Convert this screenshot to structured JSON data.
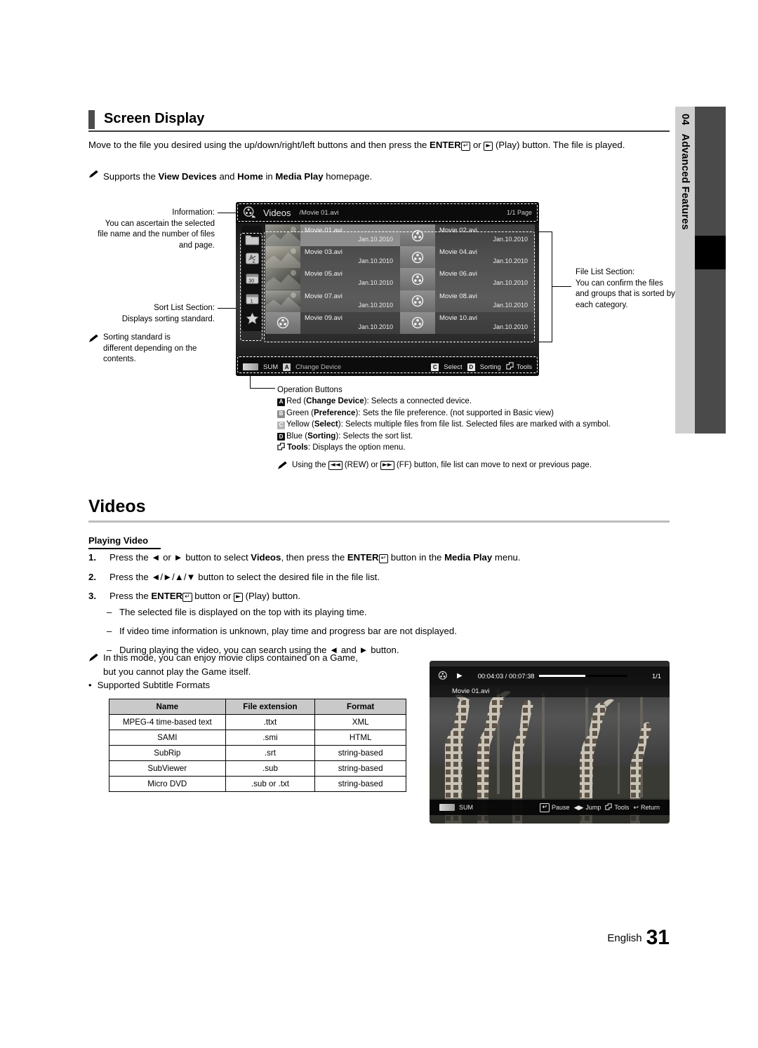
{
  "chapter_tab": {
    "number": "04",
    "label": "Advanced Features"
  },
  "section": {
    "title": "Screen Display",
    "intro_p1_a": "Move to the file you desired using the up/down/right/left buttons and then press the ",
    "intro_enter": "ENTER",
    "intro_enter_key": "↵",
    "intro_p1_b": " or ",
    "intro_play_key": "►",
    "intro_p1_c": " (Play) button. The file is played.",
    "note_a": "Supports the ",
    "note_b": "View Devices",
    "note_c": " and ",
    "note_d": "Home",
    "note_e": " in ",
    "note_f": "Media Play",
    "note_g": " homepage."
  },
  "callouts": {
    "information": "Information:\nYou can ascertain the selected file name and the number of files and page.",
    "information_l1": "Information:",
    "information_l2": "You can ascertain the selected",
    "information_l3": "file name and the number of files",
    "information_l4": "and page.",
    "sort_l1": "Sort List Section:",
    "sort_l2": "Displays sorting standard.",
    "sort_note_l1": "Sorting standard is",
    "sort_note_l2": "different depending on the",
    "sort_note_l3": "contents.",
    "filelist_l1": "File List Section:",
    "filelist_l2": "You can confirm the files",
    "filelist_l3": "and groups that is sorted by",
    "filelist_l4": "each category."
  },
  "tv_screen": {
    "header": {
      "title": "Videos",
      "path": "/Movie 01.avi",
      "page": "1/1 Page"
    },
    "sort_icons": [
      "folder-icon",
      "alphabet-sort-icon",
      "calendar-month-icon",
      "calendar-day-icon",
      "star-icon"
    ],
    "files": [
      {
        "name": "Movie 01.avi",
        "date": "Jan.10.2010",
        "thumb": "photo",
        "selected": true
      },
      {
        "name": "Movie 02.avi",
        "date": "Jan.10.2010",
        "thumb": "reel",
        "selected": false
      },
      {
        "name": "Movie 03.avi",
        "date": "Jan.10.2010",
        "thumb": "photo",
        "selected": false
      },
      {
        "name": "Movie 04.avi",
        "date": "Jan.10.2010",
        "thumb": "reel",
        "selected": false
      },
      {
        "name": "Movie 05.avi",
        "date": "Jan.10.2010",
        "thumb": "photo",
        "selected": false
      },
      {
        "name": "Movie 06.avi",
        "date": "Jan.10.2010",
        "thumb": "reel",
        "selected": false
      },
      {
        "name": "Movie 07.avi",
        "date": "Jan.10.2010",
        "thumb": "photo",
        "selected": false
      },
      {
        "name": "Movie 08.avi",
        "date": "Jan.10.2010",
        "thumb": "reel",
        "selected": false
      },
      {
        "name": "Movie 09.avi",
        "date": "Jan.10.2010",
        "thumb": "reel",
        "selected": false
      },
      {
        "name": "Movie 10.avi",
        "date": "Jan.10.2010",
        "thumb": "reel",
        "selected": false
      }
    ],
    "footer": {
      "sum": "SUM",
      "a_badge": "A",
      "change_device": "Change Device",
      "c_badge": "C",
      "select": "Select",
      "d_badge": "D",
      "sorting": "Sorting",
      "tools": "Tools"
    }
  },
  "operation_buttons": {
    "heading": "Operation Buttons",
    "rows": [
      {
        "badge": "A",
        "color": "a",
        "color_name": "Red",
        "bold": "Change Device",
        "desc": ": Selects a connected device."
      },
      {
        "badge": "B",
        "color": "b",
        "color_name": "Green",
        "bold": "Preference",
        "desc": ": Sets the file preference. (not supported in Basic view)"
      },
      {
        "badge": "C",
        "color": "c",
        "color_name": "Yellow",
        "bold": "Select",
        "desc": ": Selects multiple files from file list. Selected files are marked with a symbol."
      },
      {
        "badge": "D",
        "color": "d",
        "color_name": "Blue",
        "bold": "Sorting",
        "desc": ": Selects the sort list."
      }
    ],
    "tools_label": "Tools",
    "tools_desc": ": Displays the option menu.",
    "note_a": "Using the ",
    "note_rew": "◄◄",
    "note_b": " (REW) or ",
    "note_ff": "►►",
    "note_c": " (FF) button, file list can move to next or previous page."
  },
  "videos": {
    "heading": "Videos",
    "sub_heading": "Playing Video",
    "steps": [
      {
        "n": "1.",
        "text": "Press the ◄ or ► button to select Videos, then press the ENTER button in the Media Play menu."
      },
      {
        "n": "2.",
        "text": "Press the ◄/►/▲/▼ button to select the desired file in the file list."
      },
      {
        "n": "3.",
        "text": "Press the ENTER button or (Play) button."
      }
    ],
    "step1_a": "Press the ◄ or ► button to select ",
    "step1_b": "Videos",
    "step1_c": ", then press the ",
    "step1_enter": "ENTER",
    "step1_d": " button in the ",
    "step1_e": "Media Play",
    "step1_f": " menu.",
    "step2_text": "Press the ◄/►/▲/▼ button to select the desired file in the file list.",
    "step3_a": "Press the ",
    "step3_enter": "ENTER",
    "step3_b": " button or ",
    "step3_c": " (Play) button.",
    "dashes": [
      "The selected file is displayed on the top with its playing time.",
      "If video time information is unknown, play time and progress bar are not displayed.",
      "During playing the video, you can search using the ◄ and ► button."
    ],
    "game_note_l1": "In this mode, you can enjoy movie clips contained on a Game,",
    "game_note_l2": "but you cannot play the Game itself.",
    "bullet_text": "Supported Subtitle Formats"
  },
  "subtitle_table": {
    "headers": [
      "Name",
      "File extension",
      "Format"
    ],
    "rows": [
      [
        "MPEG-4 time-based text",
        ".ttxt",
        "XML"
      ],
      [
        "SAMI",
        ".smi",
        "HTML"
      ],
      [
        "SubRip",
        ".srt",
        "string-based"
      ],
      [
        "SubViewer",
        ".sub",
        "string-based"
      ],
      [
        "Micro DVD",
        ".sub or .txt",
        "string-based"
      ]
    ]
  },
  "playback_screenshot": {
    "time": "00:04:03 / 00:07:38",
    "page": "1/1",
    "filename": "Movie 01.avi",
    "sum": "SUM",
    "pause": "Pause",
    "jump": "Jump",
    "tools": "Tools",
    "return": "Return"
  },
  "footer": {
    "language": "English",
    "page_number": "31"
  },
  "colors": {
    "tab_gray": "#cfcfcf",
    "edge_dark": "#4a4a4a",
    "rule_gray": "#bdbdbd",
    "table_header": "#c9c9c9"
  }
}
